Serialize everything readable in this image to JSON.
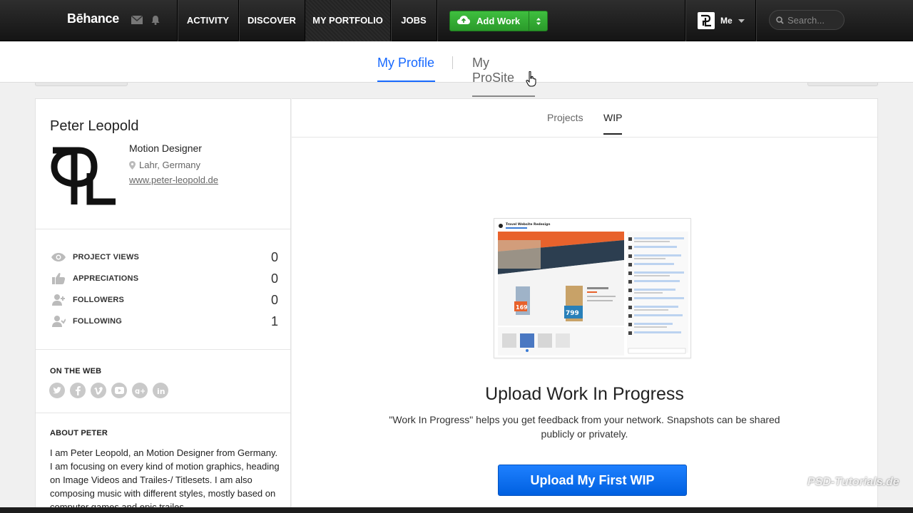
{
  "topnav": {
    "brand": "Bēhance",
    "items": [
      {
        "label": "ACTIVITY"
      },
      {
        "label": "DISCOVER"
      },
      {
        "label": "MY PORTFOLIO"
      },
      {
        "label": "JOBS"
      }
    ],
    "add_work_label": "Add Work",
    "me_label": "Me",
    "search_placeholder": "Search..."
  },
  "subnav": {
    "tabs": [
      {
        "label": "My Profile"
      },
      {
        "label": "My ProSite"
      }
    ]
  },
  "profile": {
    "name": "Peter Leopold",
    "role": "Motion Designer",
    "location": "Lahr, Germany",
    "website": "www.peter-leopold.de",
    "stats": [
      {
        "label": "PROJECT VIEWS",
        "value": "0",
        "icon": "eye-icon"
      },
      {
        "label": "APPRECIATIONS",
        "value": "0",
        "icon": "thumbs-up-icon"
      },
      {
        "label": "FOLLOWERS",
        "value": "0",
        "icon": "user-add-icon"
      },
      {
        "label": "FOLLOWING",
        "value": "1",
        "icon": "user-follow-icon"
      }
    ],
    "on_the_web_title": "ON THE WEB",
    "socials": [
      "twitter-icon",
      "facebook-icon",
      "vimeo-icon",
      "youtube-icon",
      "google-plus-icon",
      "linkedin-icon"
    ],
    "about_title": "ABOUT PETER",
    "about_text": "I am Peter Leopold, an Motion Designer from Germany. I am focusing on every kind of motion graphics, heading on Image Videos and Trailes-/ Titlesets. I am also composing music with different styles, mostly based on computer games and epic trailes."
  },
  "main": {
    "tabs": [
      {
        "label": "Projects"
      },
      {
        "label": "WIP"
      }
    ],
    "preview_title": "Travel Website Redesign",
    "upload_title": "Upload Work In Progress",
    "upload_desc": "\"Work In Progress\" helps you get feedback from your network. Snapshots can be shared publicly or privately.",
    "upload_button": "Upload My First WIP"
  },
  "watermark": "PSD-Tutorials.de",
  "colors": {
    "accent_blue": "#1769ff",
    "add_work_green": "#2ea82e",
    "nav_dark": "#1e1e1e"
  }
}
